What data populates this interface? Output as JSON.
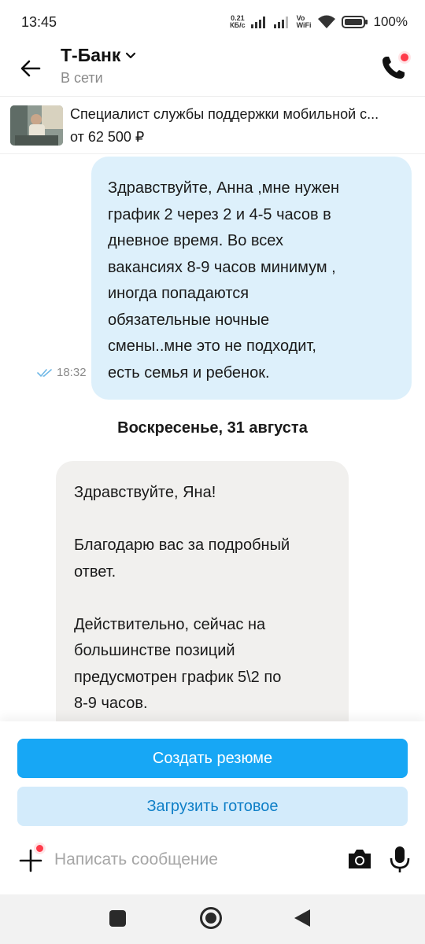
{
  "status_bar": {
    "time": "13:45",
    "net_speed_value": "0.21",
    "net_speed_unit": "КБ/с",
    "vo_wifi_top": "Vo",
    "vo_wifi_bottom": "WiFi",
    "battery": "100%",
    "icons": [
      "signal-icon",
      "signal-icon",
      "wifi-icon",
      "battery-icon"
    ]
  },
  "header": {
    "title": "Т-Банк",
    "status": "В сети",
    "icons": [
      "back-arrow-icon",
      "chevron-down-icon",
      "phone-icon"
    ],
    "notification_color": "#ff3b4a"
  },
  "vacancy": {
    "title": "Специалист службы поддержки мобильной с...",
    "salary": "от 62 500 ₽"
  },
  "messages": [
    {
      "direction": "outgoing",
      "text": "Здравствуйте, Анна ,мне нужен\nграфик 2 через 2 и 4-5 часов в\nдневное время. Во всех\nвакансиях 8-9 часов минимум ,\nиногда попадаются\nобязательные ночные\nсмены..мне это не подходит,\nесть семья и ребенок.",
      "time": "18:32",
      "read_icon": "double-check-icon"
    },
    {
      "direction": "incoming",
      "text": "Здравствуйте, Яна!\n\nБлагодарю вас за подробный\nответ.\n\nДействительно, сейчас на\nбольшинстве позиций\nпредусмотрен график 5\\2 по\n8-9 часов."
    }
  ],
  "date_divider": "Воскресенье, 31 августа",
  "actions": {
    "create_resume": "Создать резюме",
    "upload_ready": "Загрузить готовое"
  },
  "composer": {
    "placeholder": "Написать сообщение",
    "icons": [
      "plus-icon",
      "camera-icon",
      "mic-icon"
    ]
  },
  "colors": {
    "accent": "#17a7f5",
    "accent_light": "#d3ebfb",
    "outgoing_bubble": "#ddf0fb",
    "incoming_bubble": "#f1f0ee"
  }
}
